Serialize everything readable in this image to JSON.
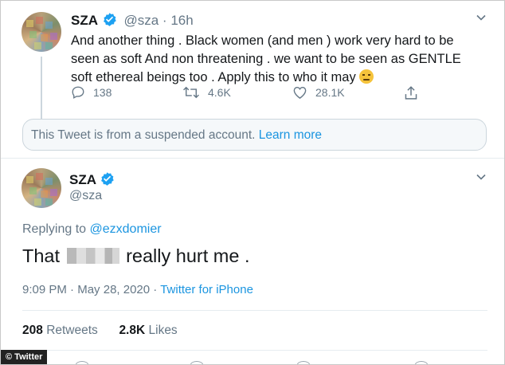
{
  "tweet1": {
    "name": "SZA",
    "handle": "@sza",
    "time": "16h",
    "text": "And another thing . Black women (and men ) work very hard to be seen as soft And non threatening . we want to be seen as GENTLE soft ethereal beings too . Apply this to who it may ",
    "replies": "138",
    "retweets": "4.6K",
    "likes": "28.1K",
    "emoji": "worried-face-icon"
  },
  "suspended_notice": {
    "text": "This Tweet is from a suspended account.",
    "link": "Learn more"
  },
  "tweet2": {
    "name": "SZA",
    "handle": "@sza",
    "replying_label": "Replying to",
    "replying_to": "@ezxdomier",
    "text_before": "That",
    "text_after": "really hurt me .",
    "time": "9:09 PM",
    "date": "May 28, 2020",
    "source": "Twitter for iPhone",
    "retweets_count": "208",
    "retweets_label": "Retweets",
    "likes_count": "2.8K",
    "likes_label": "Likes"
  },
  "watermark": "© Twitter",
  "colors": {
    "link": "#1b95e0",
    "verified": "#1da1f2",
    "muted": "#657786"
  }
}
